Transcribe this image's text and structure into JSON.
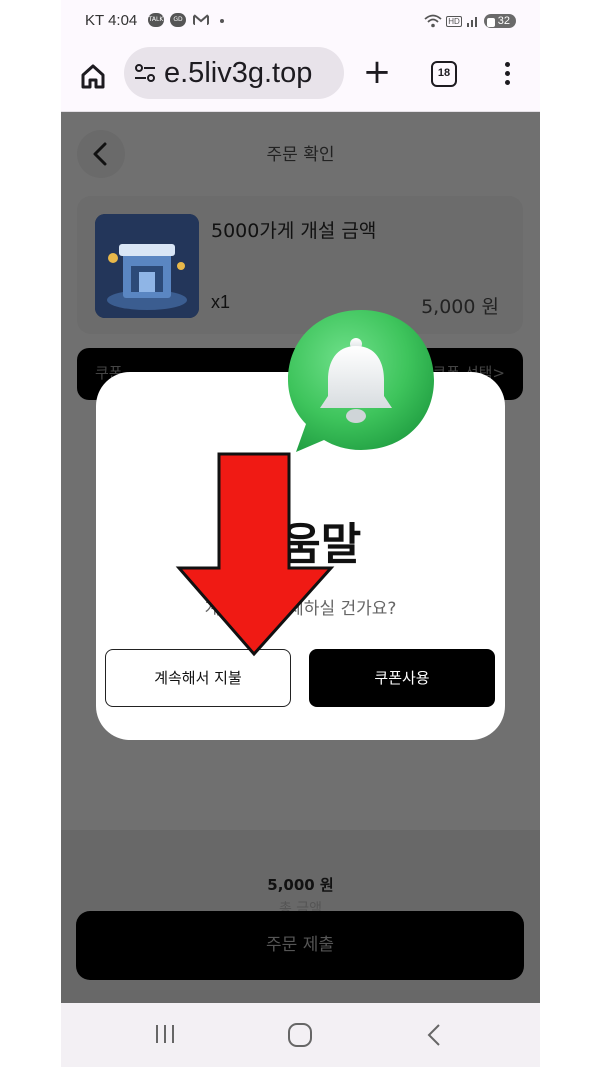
{
  "status_bar": {
    "carrier_time": "KT 4:04",
    "app_icons": [
      "TALK",
      "GD"
    ],
    "hd_label": "HD",
    "battery": "32"
  },
  "browser": {
    "url": "e.5liv3g.top",
    "tab_count": "18"
  },
  "page": {
    "title": "주문 확인",
    "product": {
      "name": "5000가게 개설 금액",
      "quantity": "x1",
      "price": "5,000 원"
    },
    "coupon_row": {
      "left_label": "쿠폰",
      "right_label": "쿠폰 선택>"
    },
    "total": {
      "amount": "5,000 원",
      "label": "총 금액"
    },
    "submit_label": "주문 제출"
  },
  "dialog": {
    "title": "도움말",
    "message": "계속해서 결제하실 건가요?",
    "continue_button": "계속해서 지불",
    "coupon_button": "쿠폰사용"
  },
  "colors": {
    "accent_green": "#3ec45c",
    "arrow_red": "#f01a14",
    "overlay_gray": "#707070"
  },
  "icons": {
    "browser": [
      "home-icon",
      "site-settings-icon",
      "plus-icon",
      "tab-count-icon",
      "more-vert-icon"
    ],
    "page": [
      "chevron-left-icon",
      "bell-icon",
      "arrow-down-icon"
    ],
    "nav": [
      "recent-apps-icon",
      "home-circle-icon",
      "nav-back-icon"
    ]
  }
}
